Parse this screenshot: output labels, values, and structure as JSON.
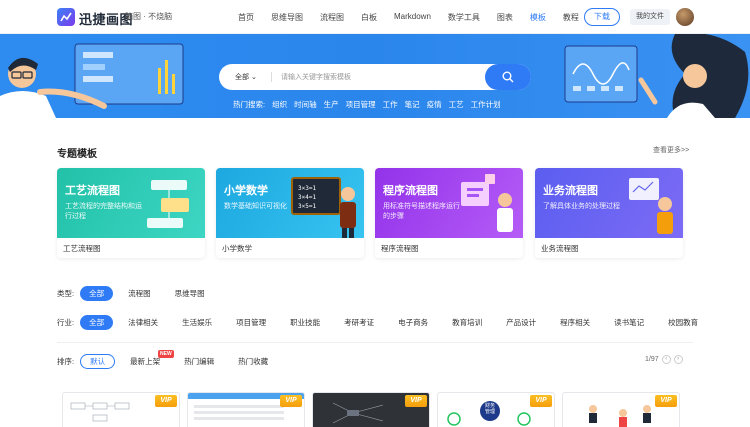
{
  "header": {
    "brand": "迅捷画图",
    "tagline": "脑图 · 不烧脑",
    "nav": [
      "首页",
      "思维导图",
      "流程图",
      "白板",
      "Markdown",
      "数学工具",
      "图表",
      "模板",
      "教程"
    ],
    "active_nav": "模板",
    "download": "下载",
    "my_files": "我的文件"
  },
  "banner": {
    "category": "全部",
    "placeholder": "请输入关键字搜索模板",
    "hot_label": "热门搜索:",
    "hot_terms": [
      "组织",
      "时间轴",
      "生产",
      "项目管理",
      "工作",
      "笔记",
      "疫情",
      "工艺",
      "工作计划"
    ]
  },
  "featured": {
    "title": "专题模板",
    "see_more": "查看更多>>",
    "cards": [
      {
        "title": "工艺流程图",
        "desc": "工艺流程的完整结构和运行过程",
        "caption": "工艺流程图",
        "color": "#2ec4b6"
      },
      {
        "title": "小学数学",
        "desc": "数学基础知识可视化",
        "caption": "小学数学",
        "color": "#26b7e8"
      },
      {
        "title": "程序流程图",
        "desc": "用标准符号描述程序运行的步骤",
        "caption": "程序流程图",
        "color": "#a855f7"
      },
      {
        "title": "业务流程图",
        "desc": "了解具体业务的处理过程",
        "caption": "业务流程图",
        "color": "#6366f1"
      }
    ]
  },
  "filters": {
    "type_label": "类型:",
    "types": [
      "全部",
      "流程图",
      "思维导图"
    ],
    "industry_label": "行业:",
    "industries": [
      "全部",
      "法律相关",
      "生活娱乐",
      "项目管理",
      "职业技能",
      "考研考证",
      "电子商务",
      "教育培训",
      "产品设计",
      "程序相关",
      "读书笔记",
      "校园教育"
    ],
    "sort_label": "排序:",
    "sorts": [
      "默认",
      "最新上架",
      "热门编辑",
      "热门收藏"
    ],
    "new_badge": "NEW",
    "pager": "1/97"
  },
  "thumbnails": {
    "vip_label": "VIP",
    "mid_card_text": "财务\n管理"
  }
}
